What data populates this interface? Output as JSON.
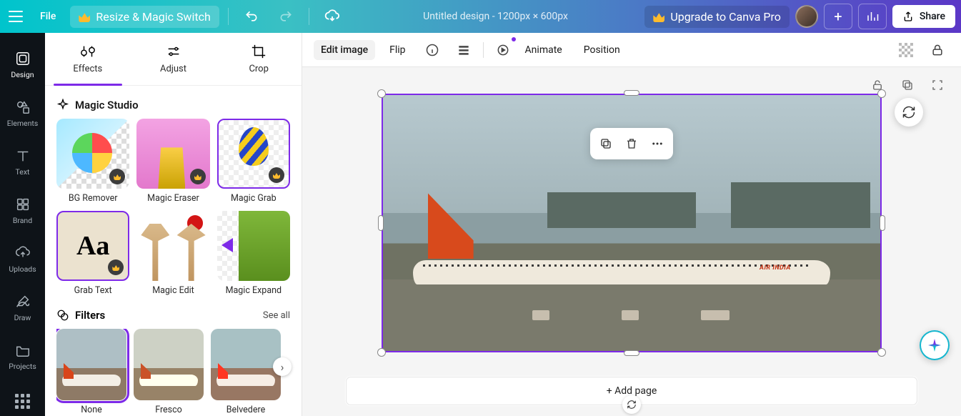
{
  "topbar": {
    "file": "File",
    "resize": "Resize & Magic Switch",
    "title": "Untitled design - 1200px × 600px",
    "upgrade": "Upgrade to Canva Pro",
    "share": "Share"
  },
  "rail": [
    {
      "label": "Design"
    },
    {
      "label": "Elements"
    },
    {
      "label": "Text"
    },
    {
      "label": "Brand"
    },
    {
      "label": "Uploads"
    },
    {
      "label": "Draw"
    },
    {
      "label": "Projects"
    }
  ],
  "panel": {
    "tabs": {
      "effects": "Effects",
      "adjust": "Adjust",
      "crop": "Crop"
    },
    "magic": {
      "head": "Magic Studio",
      "tools": [
        {
          "label": "BG Remover",
          "pro": true
        },
        {
          "label": "Magic Eraser",
          "pro": true
        },
        {
          "label": "Magic Grab",
          "pro": true
        },
        {
          "label": "Grab Text",
          "pro": true
        },
        {
          "label": "Magic Edit",
          "pro": false
        },
        {
          "label": "Magic Expand",
          "pro": true
        }
      ]
    },
    "filters": {
      "head": "Filters",
      "seeall": "See all",
      "items": [
        {
          "label": "None",
          "selected": true
        },
        {
          "label": "Fresco",
          "selected": false
        },
        {
          "label": "Belvedere",
          "selected": false
        }
      ]
    }
  },
  "ctoolbar": {
    "edit": "Edit image",
    "flip": "Flip",
    "animate": "Animate",
    "position": "Position"
  },
  "canvas": {
    "brand": "AIR INDIA",
    "addpage": "+ Add page"
  }
}
